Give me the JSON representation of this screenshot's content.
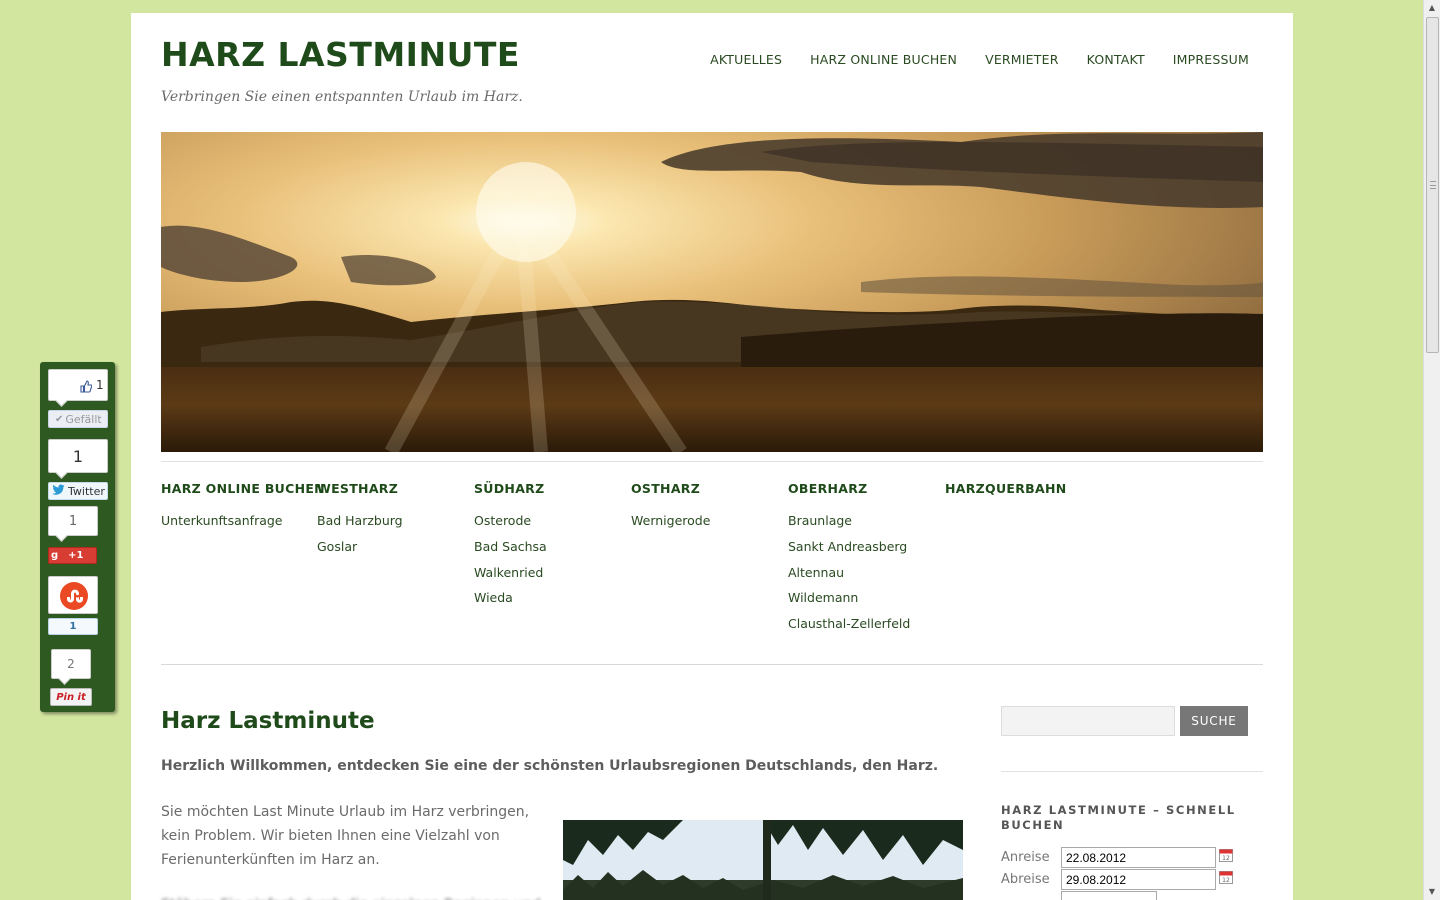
{
  "site": {
    "title": "HARZ LASTMINUTE",
    "description": "Verbringen Sie einen entspannten Urlaub im Harz."
  },
  "main_nav": [
    "AKTUELLES",
    "HARZ ONLINE BUCHEN",
    "VERMIETER",
    "KONTAKT",
    "IMPRESSUM"
  ],
  "menu_columns": [
    {
      "head": "HARZ ONLINE BUCHEN",
      "items": [
        "Unterkunftsanfrage"
      ]
    },
    {
      "head": "WESTHARZ",
      "items": [
        "Bad Harzburg",
        "Goslar"
      ]
    },
    {
      "head": "SÜDHARZ",
      "items": [
        "Osterode",
        "Bad Sachsa",
        "Walkenried",
        "Wieda"
      ]
    },
    {
      "head": "OSTHARZ",
      "items": [
        "Wernigerode"
      ]
    },
    {
      "head": "OBERHARZ",
      "items": [
        "Braunlage",
        "Sankt Andreasberg",
        "Altennau",
        "Wildemann",
        "Clausthal-Zellerfeld"
      ]
    },
    {
      "head": "HARZQUERBAHN",
      "items": []
    }
  ],
  "content": {
    "title": "Harz Lastminute",
    "intro": "Herzlich Willkommen, entdecken Sie eine der schönsten Urlaubsregionen Deutschlands, den Harz.",
    "paragraph": "Sie möchten Last Minute Urlaub im Harz verbringen, kein Problem. Wir bieten Ihnen eine Vielzahl von Ferienunterkünften im Harz an."
  },
  "sidebar": {
    "search_button": "SUCHE",
    "search_value": "",
    "widget_title": "HARZ LASTMINUTE – SCHNELL BUCHEN",
    "form": {
      "anreise_label": "Anreise",
      "anreise_value": "22.08.2012",
      "abreise_label": "Abreise",
      "abreise_value": "29.08.2012"
    }
  },
  "social": {
    "facebook_count": "1",
    "facebook_label": "Gefällt",
    "twitter_count": "1",
    "twitter_label": "Twitter",
    "gplus_count": "1",
    "gplus_label": "+1",
    "stumble_count": "1",
    "pinterest_count": "2",
    "pinterest_label": "Pin it"
  },
  "colors": {
    "background": "#d3e6a0",
    "title_green": "#1f4a1a",
    "social_bar": "#2e5a22",
    "search_button": "#777777"
  }
}
